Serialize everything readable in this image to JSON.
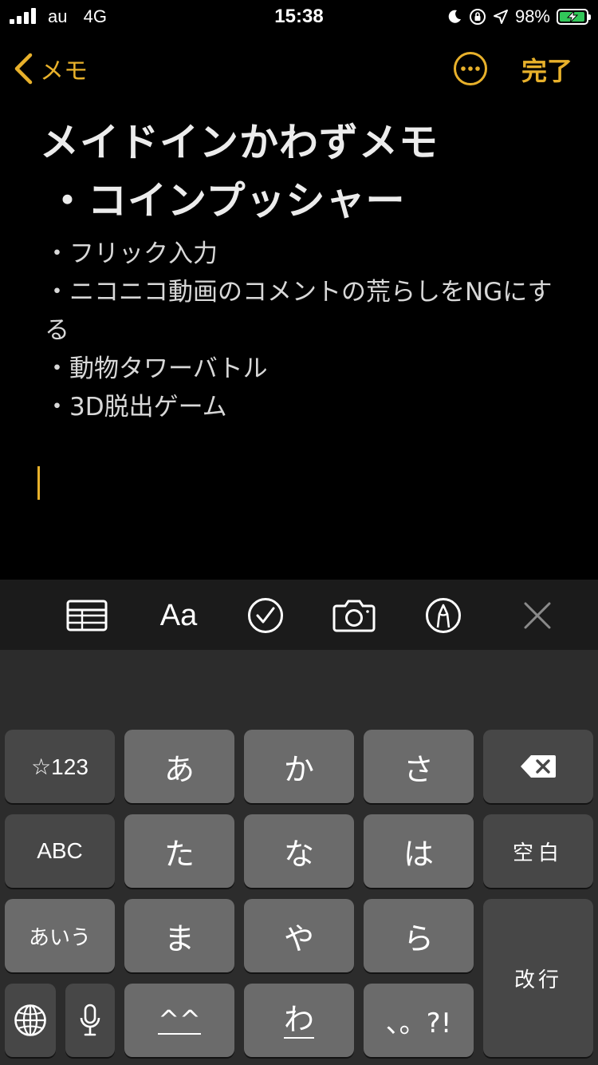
{
  "status_bar": {
    "carrier": "au",
    "network": "4G",
    "time": "15:38",
    "battery_percent": "98%",
    "battery_level": 0.98,
    "battery_color": "#32c759"
  },
  "nav": {
    "back_label": "メモ",
    "done_label": "完了",
    "accent_color": "#e8b12b"
  },
  "note": {
    "title": "メイドインかわずメモ",
    "heading": "・コインプッシャー",
    "items": [
      "・フリック入力",
      "・ニコニコ動画のコメントの荒らしをNGにする",
      "・動物タワーバトル",
      "・3D脱出ゲーム"
    ]
  },
  "toolbar": {
    "items": [
      "table-icon",
      "format-icon",
      "checklist-icon",
      "camera-icon",
      "markup-icon",
      "close-icon"
    ],
    "format_label": "Aa"
  },
  "keyboard": {
    "symbols_key": "☆123",
    "abc_key": "ABC",
    "kana_mode_key": "あいう",
    "rows": [
      [
        "あ",
        "か",
        "さ"
      ],
      [
        "た",
        "な",
        "は"
      ],
      [
        "ま",
        "や",
        "ら"
      ],
      [
        "^^",
        "わ",
        "、。?!"
      ]
    ],
    "space_key": "空白",
    "return_key": "改行"
  }
}
